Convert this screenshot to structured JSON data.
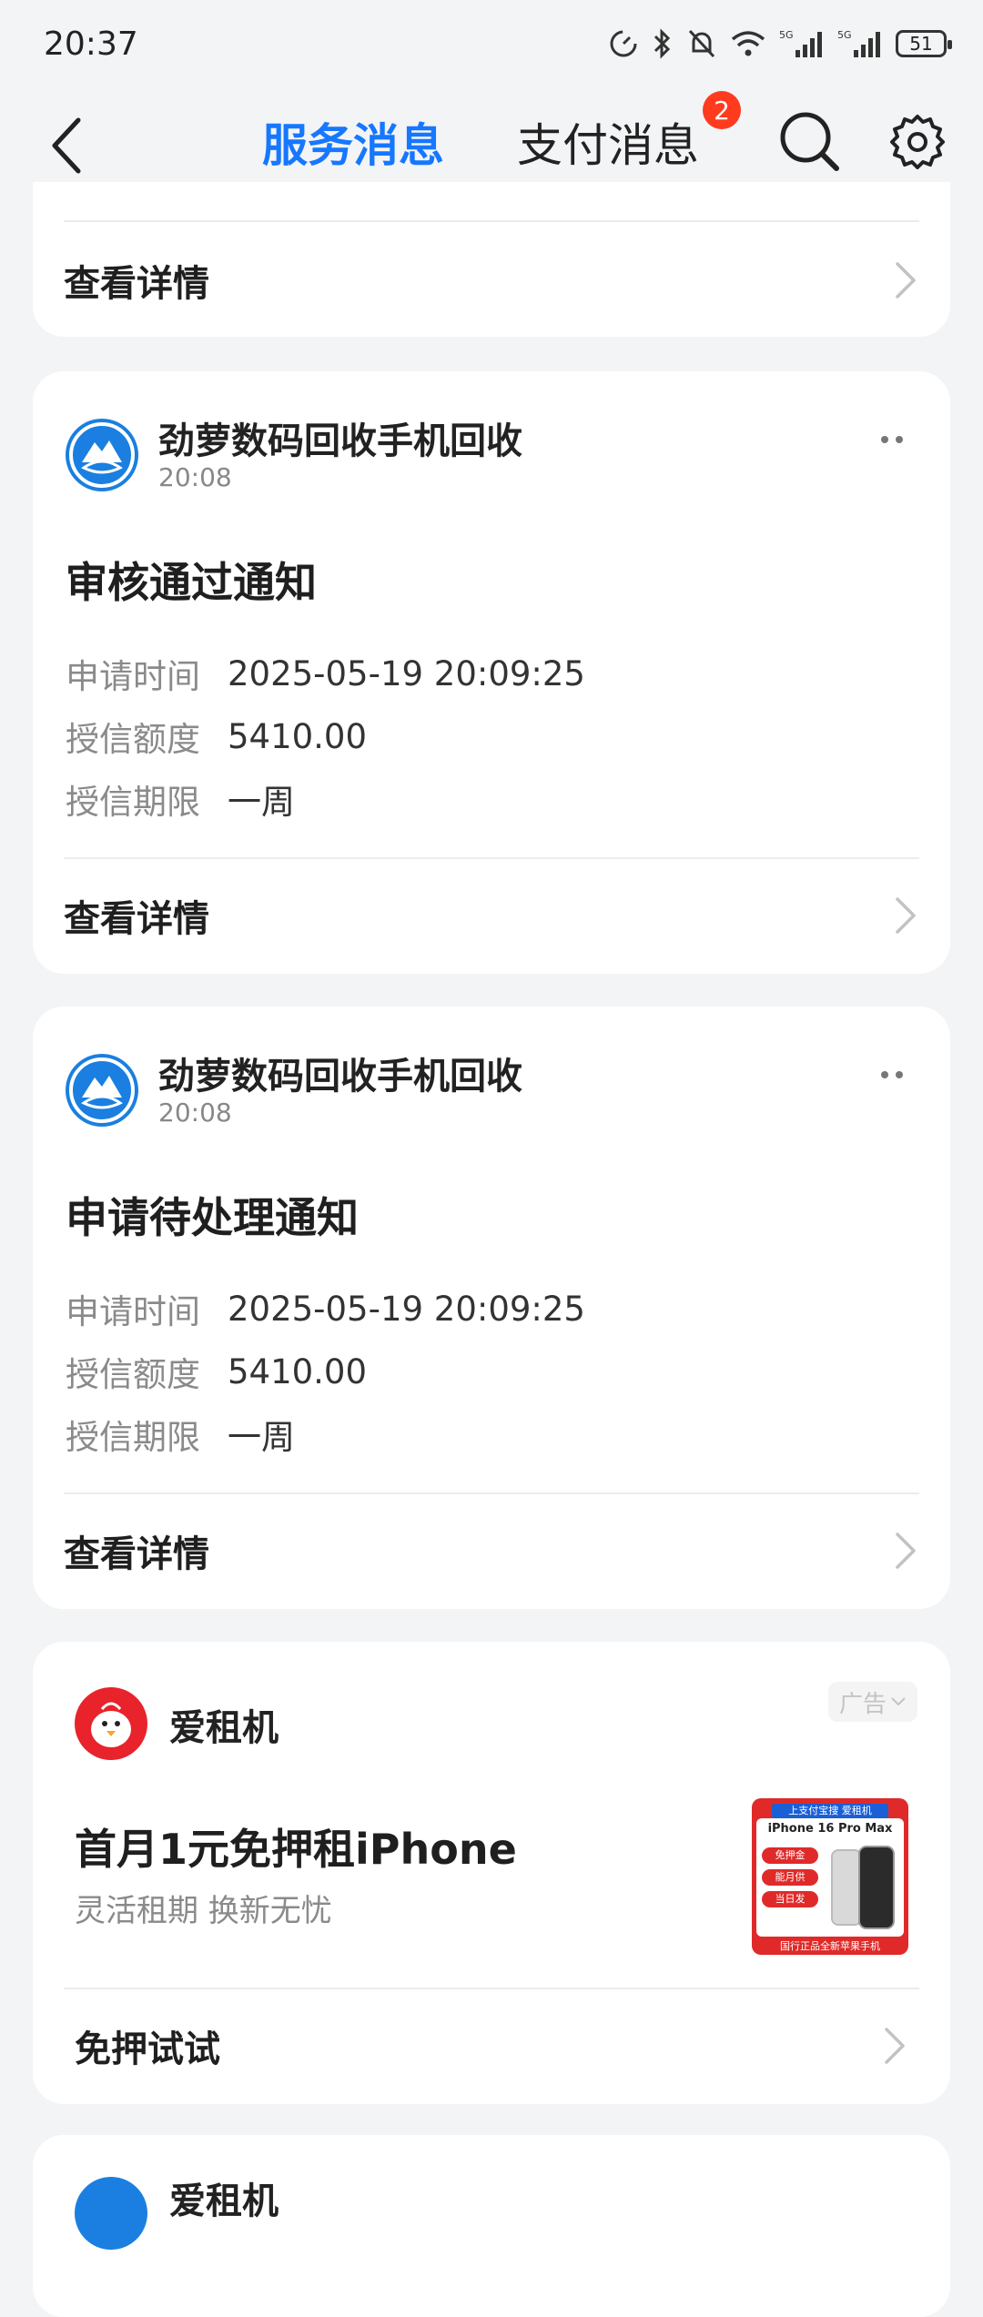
{
  "status_bar": {
    "time": "20:37",
    "battery": "51",
    "icons": [
      "speed-icon",
      "bluetooth-icon",
      "mute-icon",
      "wifi-icon",
      "signal-5g-icon",
      "signal-5g-icon"
    ]
  },
  "header": {
    "tabs": [
      {
        "label": "服务消息",
        "active": true
      },
      {
        "label": "支付消息",
        "active": false,
        "badge": "2"
      }
    ],
    "accent_color": "#1677ff",
    "badge_color": "#ff3b1f"
  },
  "top_card": {
    "detail_label": "查看详情"
  },
  "messages": [
    {
      "merchant": "劲萝数码回收手机回收",
      "time": "20:08",
      "title": "审核通过通知",
      "rows": [
        {
          "label": "申请时间",
          "value": "2025-05-19 20:09:25"
        },
        {
          "label": "授信额度",
          "value": "5410.00"
        },
        {
          "label": "授信期限",
          "value": "一周"
        }
      ],
      "detail_label": "查看详情"
    },
    {
      "merchant": "劲萝数码回收手机回收",
      "time": "20:08",
      "title": "申请待处理通知",
      "rows": [
        {
          "label": "申请时间",
          "value": "2025-05-19 20:09:25"
        },
        {
          "label": "授信额度",
          "value": "5410.00"
        },
        {
          "label": "授信期限",
          "value": "一周"
        }
      ],
      "detail_label": "查看详情"
    }
  ],
  "ad": {
    "name": "爱租机",
    "tag": "广告",
    "title": "首月1元免押租iPhone",
    "subtitle": "灵活租期 换新无忧",
    "action_label": "免押试试",
    "image": {
      "header": "上支付宝搜 爱租机",
      "model": "iPhone 16 Pro Max",
      "badges": [
        "免押金",
        "能月供",
        "当日发"
      ],
      "footer": "国行正品全新苹果手机"
    }
  },
  "peek_card": {
    "name": "爱租机"
  }
}
